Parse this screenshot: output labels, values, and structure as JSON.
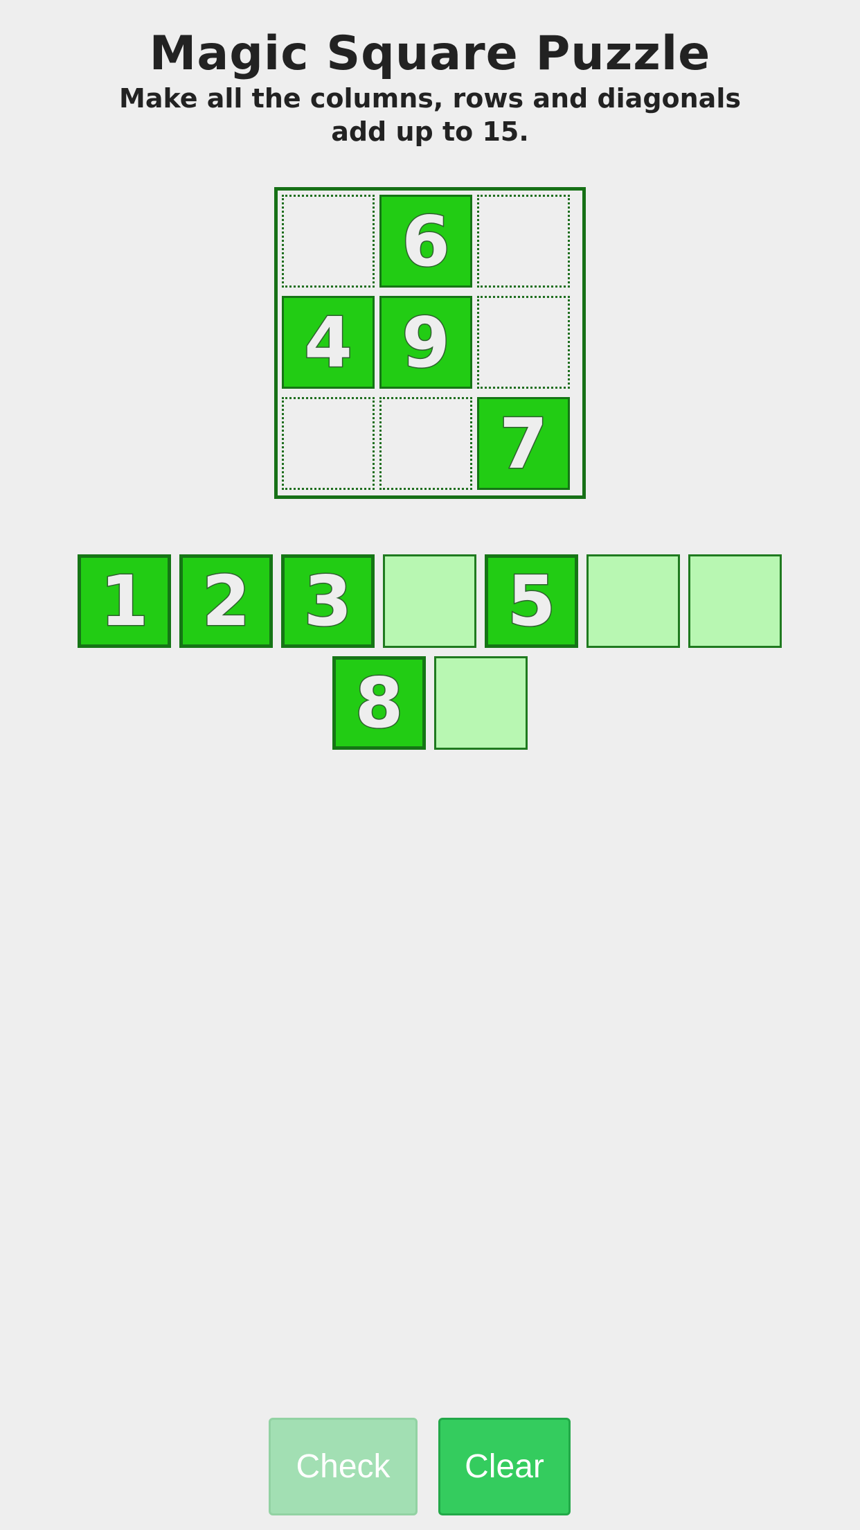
{
  "header": {
    "title": "Magic Square Puzzle",
    "subtitle": "Make all the columns, rows and diagonals add up to 15."
  },
  "board": {
    "cells": [
      {
        "value": ""
      },
      {
        "value": "6"
      },
      {
        "value": ""
      },
      {
        "value": "4"
      },
      {
        "value": "9"
      },
      {
        "value": ""
      },
      {
        "value": ""
      },
      {
        "value": ""
      },
      {
        "value": "7"
      }
    ]
  },
  "tray": {
    "slots": [
      {
        "value": "1"
      },
      {
        "value": "2"
      },
      {
        "value": "3"
      },
      {
        "value": ""
      },
      {
        "value": "5"
      },
      {
        "value": ""
      },
      {
        "value": ""
      },
      {
        "value": "8"
      },
      {
        "value": ""
      }
    ]
  },
  "buttons": {
    "check_label": "Check",
    "clear_label": "Clear"
  },
  "colors": {
    "tile_fill": "#22cc14",
    "tile_border": "#157515",
    "empty_slot": "#b8f7b2",
    "background": "#eeeeee",
    "check_button_disabled": "#a2dfb3",
    "clear_button": "#34cc5e"
  }
}
